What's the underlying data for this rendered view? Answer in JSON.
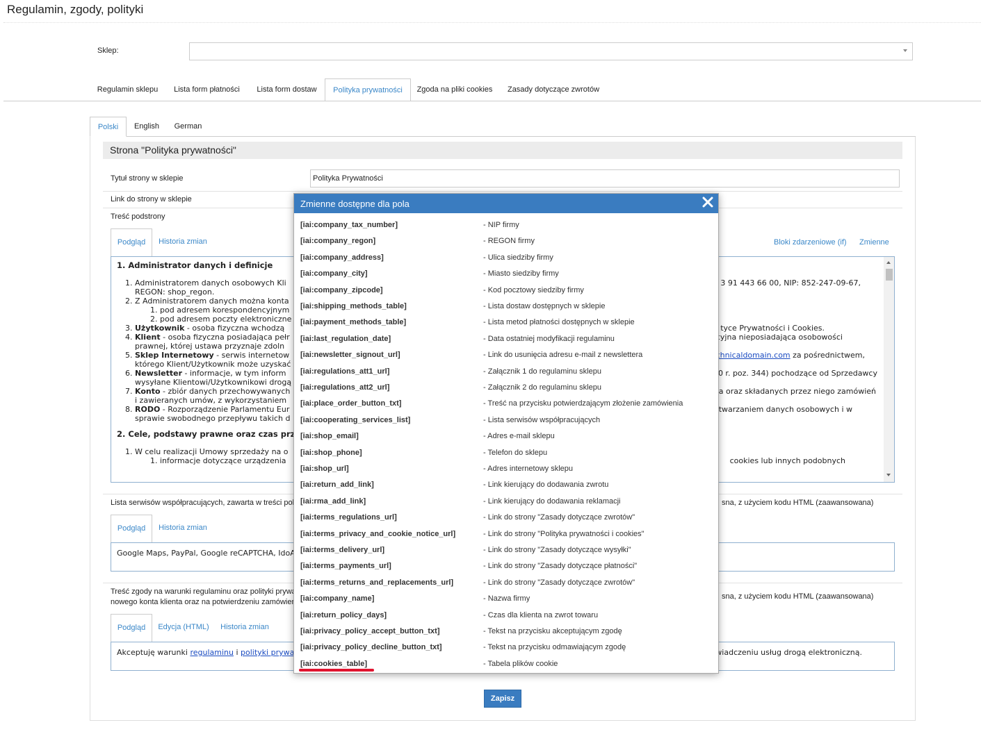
{
  "page_title": "Regulamin, zgody, polityki",
  "shop": {
    "label": "Sklep:",
    "value": ""
  },
  "main_tabs": [
    {
      "label": "Regulamin sklepu"
    },
    {
      "label": "Lista form płatności"
    },
    {
      "label": "Lista form dostaw"
    },
    {
      "label": "Polityka prywatności",
      "active": true
    },
    {
      "label": "Zgoda na pliki cookies"
    },
    {
      "label": "Zasady dotyczące zwrotów"
    }
  ],
  "lang_tabs": [
    {
      "label": "Polski",
      "active": true
    },
    {
      "label": "English"
    },
    {
      "label": "German"
    }
  ],
  "section_title": "Strona \"Polityka prywatności\"",
  "fields": {
    "title_label": "Tytuł strony w sklepie",
    "title_value": "Polityka Prywatności",
    "link_label": "Link do strony w sklepie",
    "content_label": "Treść podstrony"
  },
  "content_editor": {
    "tab_preview": "Podgląd",
    "tab_history": "Historia zmian",
    "link_blocks": "Bloki zdarzeniowe (if)",
    "link_variables": "Zmienne",
    "h1": "1. Administrator danych i definicje",
    "items": [
      {
        "left": "Administratorem danych osobowych Kli",
        "right": "3 91 443 66 00, NIP: 852-247-09-67,",
        "line2": "REGON: shop_regon."
      },
      {
        "left": "Z Administratorem danych można konta"
      },
      {
        "sub": "pod adresem korespondencyjnym"
      },
      {
        "sub": "pod adresem poczty elektroniczne"
      },
      {
        "bold": "Użytkownik",
        "left": " - osoba fizyczna wchodzą",
        "right": "tyce Prywatności i Cookies."
      },
      {
        "bold": "Klient",
        "left": " - osoba fizyczna posiadająca pełr",
        "right": "cyjna nieposiadająca osobowości",
        "line2": "prawnej, której ustawa przyznaje zdoln"
      },
      {
        "bold": "Sklep Internetowy",
        "left": " - serwis internetow",
        "right_link": "chnicaldomain.com",
        "right": " za pośrednictwem,",
        "line2": "którego Klient/Użytkownik może uzyskać"
      },
      {
        "bold": "Newsletter",
        "left": " - informacje, w tym inform",
        "right": "0 r. poz. 344) pochodzące od Sprzedawcy",
        "line2": "wysyłane Klientowi/Użytkownikowi drogą"
      },
      {
        "bold": "Konto",
        "left": " - zbiór danych przechowywanych",
        "right": "ka oraz składanych przez niego zamówień",
        "line2": "i zawieranych umów, z wykorzystaniem"
      },
      {
        "bold": "RODO",
        "left": " - Rozporządzenie Parlamentu Eur",
        "right": "twarzaniem danych osobowych i w",
        "line2": "sprawie swobodnego przepływu takich d"
      }
    ],
    "h2": "2. Cele, podstawy prawne oraz czas przetw",
    "item_2_1": "W celu realizacji Umowy sprzedaży na o",
    "item_2_1_1": "informacje dotyczące urządzenia",
    "item_2_1_1_right": "cookies lub innych podobnych"
  },
  "services": {
    "label": "Lista serwisów współpracujących, zawarta w treści pol",
    "label_right": "sna, z użyciem kodu HTML (zaawansowana)",
    "tab_preview": "Podgląd",
    "tab_history": "Historia zmian",
    "text": "Google Maps, PayPal, Google reCAPTCHA, IdoA"
  },
  "consent": {
    "label_line1": "Treść zgody na warunki regulaminu oraz polityki prywa",
    "label_line2": "nowego konta klienta oraz na potwierdzeniu zamówien",
    "label_right": "sna, z użyciem kodu HTML (zaawansowana)",
    "tab_preview": "Podgląd",
    "tab_edit": "Edycja (HTML)",
    "tab_history": "Historia zmian",
    "text_start": "Akceptuję warunki ",
    "link1": "regulaminu",
    "text_mid": " i ",
    "link2": "polityki prywat",
    "text_end": "wiadczeniu usług drogą elektroniczną."
  },
  "save_button": "Zapisz",
  "modal": {
    "title": "Zmienne dostępne dla pola",
    "variables": [
      {
        "name": "[iai:company_tax_number]",
        "desc": "- NIP firmy"
      },
      {
        "name": "[iai:company_regon]",
        "desc": "- REGON firmy"
      },
      {
        "name": "[iai:company_address]",
        "desc": "- Ulica siedziby firmy"
      },
      {
        "name": "[iai:company_city]",
        "desc": "- Miasto siedziby firmy"
      },
      {
        "name": "[iai:company_zipcode]",
        "desc": "- Kod pocztowy siedziby firmy"
      },
      {
        "name": "[iai:shipping_methods_table]",
        "desc": "- Lista dostaw dostępnych w sklepie"
      },
      {
        "name": "[iai:payment_methods_table]",
        "desc": "- Lista metod płatności dostępnych w sklepie"
      },
      {
        "name": "[iai:last_regulation_date]",
        "desc": "- Data ostatniej modyfikacji regulaminu"
      },
      {
        "name": "[iai:newsletter_signout_url]",
        "desc": "- Link do usunięcia adresu e-mail z newslettera"
      },
      {
        "name": "[iai:regulations_att1_url]",
        "desc": "- Załącznik 1 do regulaminu sklepu"
      },
      {
        "name": "[iai:regulations_att2_url]",
        "desc": "- Załącznik 2 do regulaminu sklepu"
      },
      {
        "name": "[iai:place_order_button_txt]",
        "desc": "- Treść na przycisku potwierdzającym złożenie zamówienia"
      },
      {
        "name": "[iai:cooperating_services_list]",
        "desc": "- Lista serwisów współpracujących"
      },
      {
        "name": "[iai:shop_email]",
        "desc": "- Adres e-mail sklepu"
      },
      {
        "name": "[iai:shop_phone]",
        "desc": "- Telefon do sklepu"
      },
      {
        "name": "[iai:shop_url]",
        "desc": "- Adres internetowy sklepu"
      },
      {
        "name": "[iai:return_add_link]",
        "desc": "- Link kierujący do dodawania zwrotu"
      },
      {
        "name": "[iai:rma_add_link]",
        "desc": "- Link kierujący do dodawania reklamacji"
      },
      {
        "name": "[iai:terms_regulations_url]",
        "desc": "- Link do strony \"Zasady dotyczące zwrotów\""
      },
      {
        "name": "[iai:terms_privacy_and_cookie_notice_url]",
        "desc": "- Link do strony \"Polityka prywatności i cookies\""
      },
      {
        "name": "[iai:terms_delivery_url]",
        "desc": "- Link do strony \"Zasady dotyczące wysyłki\""
      },
      {
        "name": "[iai:terms_payments_url]",
        "desc": "- Link do strony \"Zasady dotyczące płatności\""
      },
      {
        "name": "[iai:terms_returns_and_replacements_url]",
        "desc": "- Link do strony \"Zasady dotyczące zwrotów\""
      },
      {
        "name": "[iai:company_name]",
        "desc": "- Nazwa firmy"
      },
      {
        "name": "[iai:return_policy_days]",
        "desc": "- Czas dla klienta na zwrot towaru"
      },
      {
        "name": "[iai:privacy_policy_accept_button_txt]",
        "desc": "- Tekst na przycisku akceptującym zgodę"
      },
      {
        "name": "[iai:privacy_policy_decline_button_txt]",
        "desc": "- Tekst na przycisku odmawiającym zgodę"
      },
      {
        "name": "[iai:cookies_table]",
        "desc": "- Tabela plików cookie"
      }
    ]
  },
  "colors": {
    "accent": "#3a7cc0",
    "link": "#3a87c8",
    "highlight": "#e0142f"
  }
}
